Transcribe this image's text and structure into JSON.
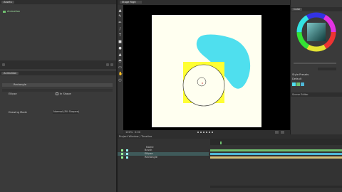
{
  "colors": {
    "background": "#2a2a2a",
    "panel": "#3a3a3a",
    "canvas_bg": "#fffff0",
    "cyan_shape": "#4fdfee",
    "yellow_shape": "#ffff33",
    "selection_green": "#3f8f3f",
    "timeline_green": "#6fbf6f",
    "timeline_blue": "#4fb8d8",
    "timeline_tan": "#d4c07a"
  },
  "left_top": {
    "tab": "Assets",
    "item": "Animation"
  },
  "left_mid": {
    "tab": "Animation",
    "layer_name": "Rectangle",
    "sub_label": "Ellipse",
    "checkbox_label": "In Shape",
    "prop_label": "Drawing Mode",
    "prop_value": "Normal (Fill Shapes)"
  },
  "tools": [
    "select-icon",
    "brush-icon",
    "pen-icon",
    "pencil-icon",
    "text-icon",
    "rect-icon",
    "ellipse-icon",
    "fill-icon",
    "eyedropper-icon",
    "eraser-icon",
    "hand-icon",
    "zoom-icon"
  ],
  "stage": {
    "tab": "Stage Right",
    "zoom": "100%",
    "time": "0:00"
  },
  "right": {
    "color_tab": "Color",
    "style_label": "Style Presets",
    "style_value": "Default",
    "scene_tab": "Scene Editor"
  },
  "timeline": {
    "tab": "Project Window / Timeline",
    "col_name": "Name",
    "layers": [
      {
        "name": "Brush",
        "color": "#6fbf6f"
      },
      {
        "name": "Ellipse",
        "color": "#4fb8d8"
      },
      {
        "name": "Rectangle",
        "color": "#d4c07a"
      }
    ]
  }
}
